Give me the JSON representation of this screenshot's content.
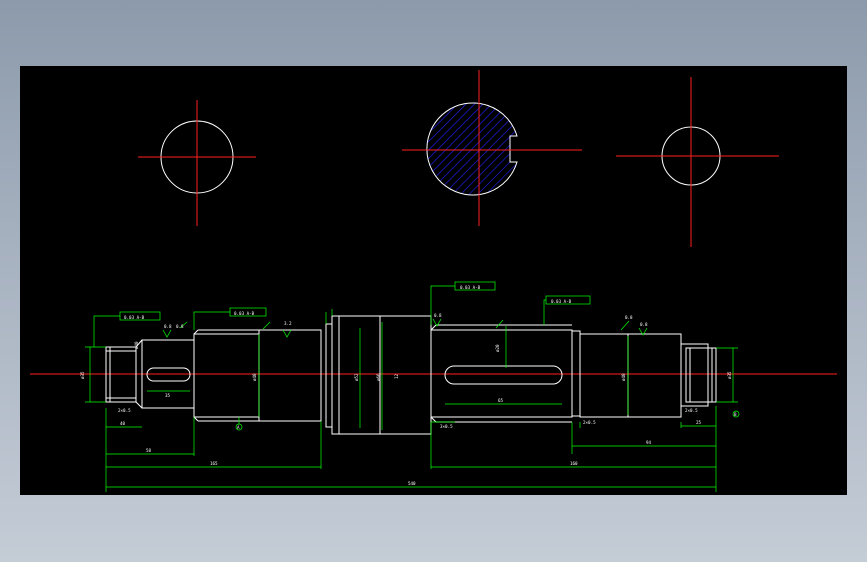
{
  "colors": {
    "background": "#000000",
    "centerline": "#ff2020",
    "outline": "#ffffff",
    "dimension": "#00ff00",
    "hatch": "#2020ff",
    "leader": "#00ff00"
  },
  "annotations": {
    "tolerance_left": "0.03 A-B",
    "tolerance_left2": "0.03 A-B",
    "tolerance_mid": "0.03 A-B",
    "tolerance_right": "0.03 A-B",
    "roughness_a": "0.8",
    "roughness_b": "3.2",
    "roughness_c": "0.8",
    "roughness_d": "0.8",
    "roughness_e": "0.8",
    "roughness_f": "0.8",
    "dia_left_end": "ø35",
    "dia_left_bearing": "ø40",
    "dia_collar": "ø52",
    "dia_center": "ø66",
    "dia_mid": "ø40",
    "dia_right_bearing": "ø40",
    "dia_right_end": "ø35",
    "keyway_depth": "ø20",
    "chamfer_left": "2×0.5",
    "chamfer_right": "2×0.5",
    "chamfer_r2": "2×0.5",
    "fillet_mid": "3×0.5",
    "len_a": "40",
    "len_key_left": "35",
    "len_b": "58",
    "len_c": "165",
    "len_d": "160",
    "len_e": "94",
    "len_f": "25",
    "len_key_mid": "65",
    "len_total": "540",
    "datum_a": "A",
    "datum_b": "B",
    "section_note": "12"
  }
}
